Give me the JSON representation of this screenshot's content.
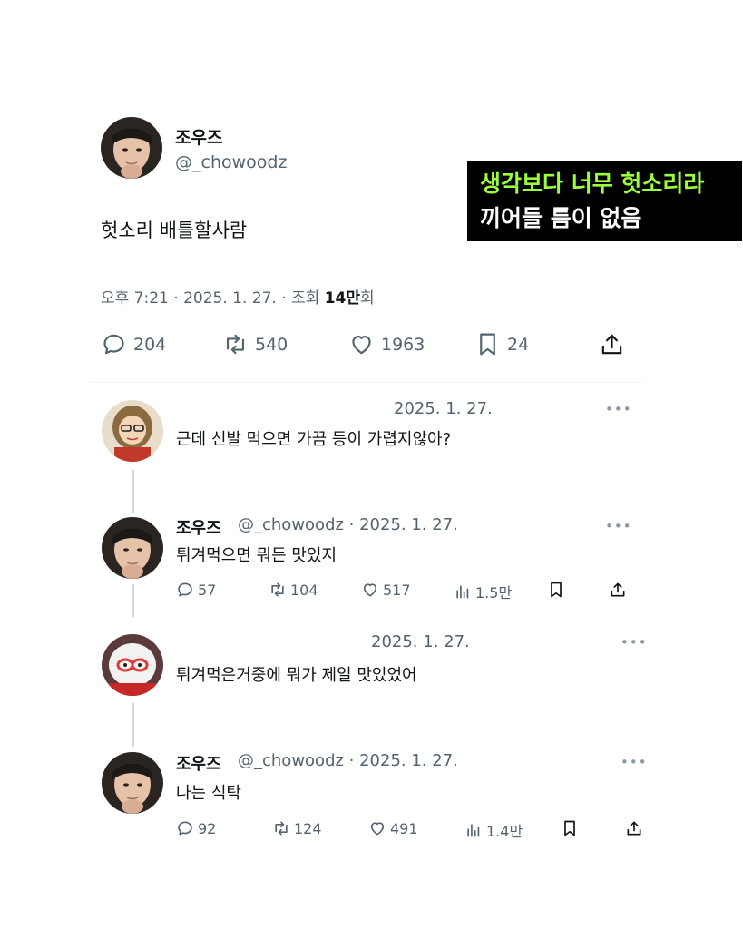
{
  "main": {
    "name": "조우즈",
    "handle": "@_chowoodz",
    "text": "헛소리 배틀할사람",
    "meta_prefix": "오후 7:21 · 2025. 1. 27. · 조회 ",
    "views": "14만",
    "views_suffix": "회",
    "replies": "204",
    "retweets": "540",
    "likes": "1963",
    "bookmarks": "24"
  },
  "caption": {
    "line1": "생각보다 너무 헛소리라",
    "line2": "끼어들 틈이 없음"
  },
  "replies": [
    {
      "date": "2025. 1. 27.",
      "text": "근데 신발 먹으면 가끔  등이 가렵지않아?"
    },
    {
      "name": "조우즈",
      "handle": "@_chowoodz · 2025. 1. 27.",
      "text": "튀겨먹으면 뭐든 맛있지",
      "replies": "57",
      "retweets": "104",
      "likes": "517",
      "views": "1.5만"
    },
    {
      "date": "2025. 1. 27.",
      "text": "튀겨먹은거중에 뭐가 제일 맛있었어"
    },
    {
      "name": "조우즈",
      "handle": "@_chowoodz · 2025. 1. 27.",
      "text": "나는 식탁",
      "replies": "92",
      "retweets": "124",
      "likes": "491",
      "views": "1.4만"
    }
  ],
  "more_glyph": "•••",
  "colors": {
    "caption_highlight": "#9bff3a",
    "secondary_text": "#536471",
    "thread_line": "#cfd9de"
  }
}
